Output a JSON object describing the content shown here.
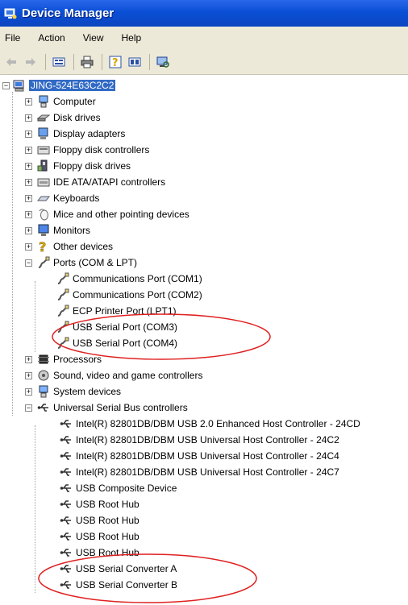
{
  "window": {
    "title": "Device Manager"
  },
  "menu": {
    "file": "File",
    "action": "Action",
    "view": "View",
    "help": "Help"
  },
  "tree": {
    "root": "JING-524E63C2C2",
    "categories": {
      "computer": "Computer",
      "disk": "Disk drives",
      "display": "Display adapters",
      "floppyctl": "Floppy disk controllers",
      "floppydrv": "Floppy disk drives",
      "ide": "IDE ATA/ATAPI controllers",
      "keyboards": "Keyboards",
      "mice": "Mice and other pointing devices",
      "monitors": "Monitors",
      "other": "Other devices",
      "ports": "Ports (COM & LPT)",
      "processors": "Processors",
      "sound": "Sound, video and game controllers",
      "system": "System devices",
      "usb": "Universal Serial Bus controllers"
    },
    "ports_children": [
      "Communications Port (COM1)",
      "Communications Port (COM2)",
      "ECP Printer Port (LPT1)",
      "USB Serial Port (COM3)",
      "USB Serial Port (COM4)"
    ],
    "usb_children": [
      "Intel(R) 82801DB/DBM USB 2.0 Enhanced Host Controller - 24CD",
      "Intel(R) 82801DB/DBM USB Universal Host Controller - 24C2",
      "Intel(R) 82801DB/DBM USB Universal Host Controller - 24C4",
      "Intel(R) 82801DB/DBM USB Universal Host Controller - 24C7",
      "USB Composite Device",
      "USB Root Hub",
      "USB Root Hub",
      "USB Root Hub",
      "USB Root Hub",
      "USB Serial Converter A",
      "USB Serial Converter B"
    ]
  },
  "colors": {
    "highlight_ellipse": "#e02020",
    "selection": "#316ac5",
    "titlebar": "#0a4fd6"
  }
}
